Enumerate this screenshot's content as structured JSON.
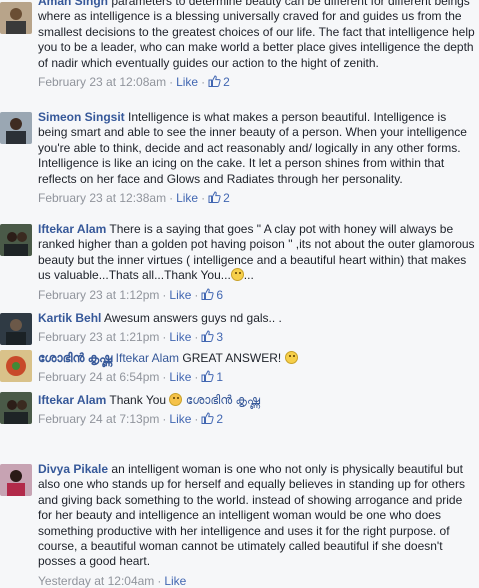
{
  "comments": [
    {
      "author": "Aman Singh",
      "text": "parameters to determine beauty can be different for different beings where as intelligence is a blessing universally craved for and guides us from the smallest decisions to the greatest choices of our life. The fact that intelligence help you to be a leader, who can make world a better place gives intelligence the depth of nadir which eventually guides our action to the hight of zenith.",
      "date": "February 23 at 12:08am",
      "like": "Like",
      "likes": "2"
    },
    {
      "author": "Simeon Singsit",
      "text": "Intelligence is what makes a person beautiful. Intelligence is being smart and able to see the inner beauty of a person. When your intelligence you're able to think, decide and act reasonably and/ logically in any other forms. Intelligence is like an icing on the cake. It let a person shines from within that reflects on her face and Glows and Radiates through her personality.",
      "date": "February 23 at 12:38am",
      "like": "Like",
      "likes": "2"
    },
    {
      "author": "Iftekar Alam",
      "text": "There is a saying that goes \" A clay pot with honey will always be ranked higher than a golden pot having poison \" ,its not about the outer glamorous beauty but the inner virtues ( intelligence and a beautiful heart within) that makes us valuable...Thats all...Thank You...",
      "text_after": "...",
      "date": "February 23 at 1:12pm",
      "like": "Like",
      "likes": "6"
    },
    {
      "author": "Kartik Behl",
      "text": "Awesum answers guys nd gals.. .",
      "date": "February 23 at 1:21pm",
      "like": "Like",
      "likes": "3"
    },
    {
      "author": "ശോഭിൻ കൃഷ്ണ",
      "mention": "Iftekar Alam",
      "text": "GREAT ANSWER!",
      "date": "February 24 at 6:54pm",
      "like": "Like",
      "likes": "1"
    },
    {
      "author": "Iftekar Alam",
      "text": "Thank You",
      "mention_after": "ശോഭിൻ കൃഷ്ണ",
      "date": "February 24 at 7:13pm",
      "like": "Like",
      "likes": "2"
    },
    {
      "author": "Divya Pikale",
      "text": "an intelligent woman is one who not only is physically beautiful but also one who stands up for herself and equally believes in standing up for others and giving back something to the world. instead of showing arrogance and pride for her beauty and intelligence an intelligent woman would be one who does something productive with her intelligence and uses it for the right purpose. of course, a beautiful woman cannot be utimately called beautiful if she doesn't posses a good heart.",
      "date": "Yesterday at 12:04am",
      "like": "Like"
    }
  ],
  "colors": {
    "link": "#365899",
    "meta": "#90949c",
    "action": "#4267b2"
  }
}
